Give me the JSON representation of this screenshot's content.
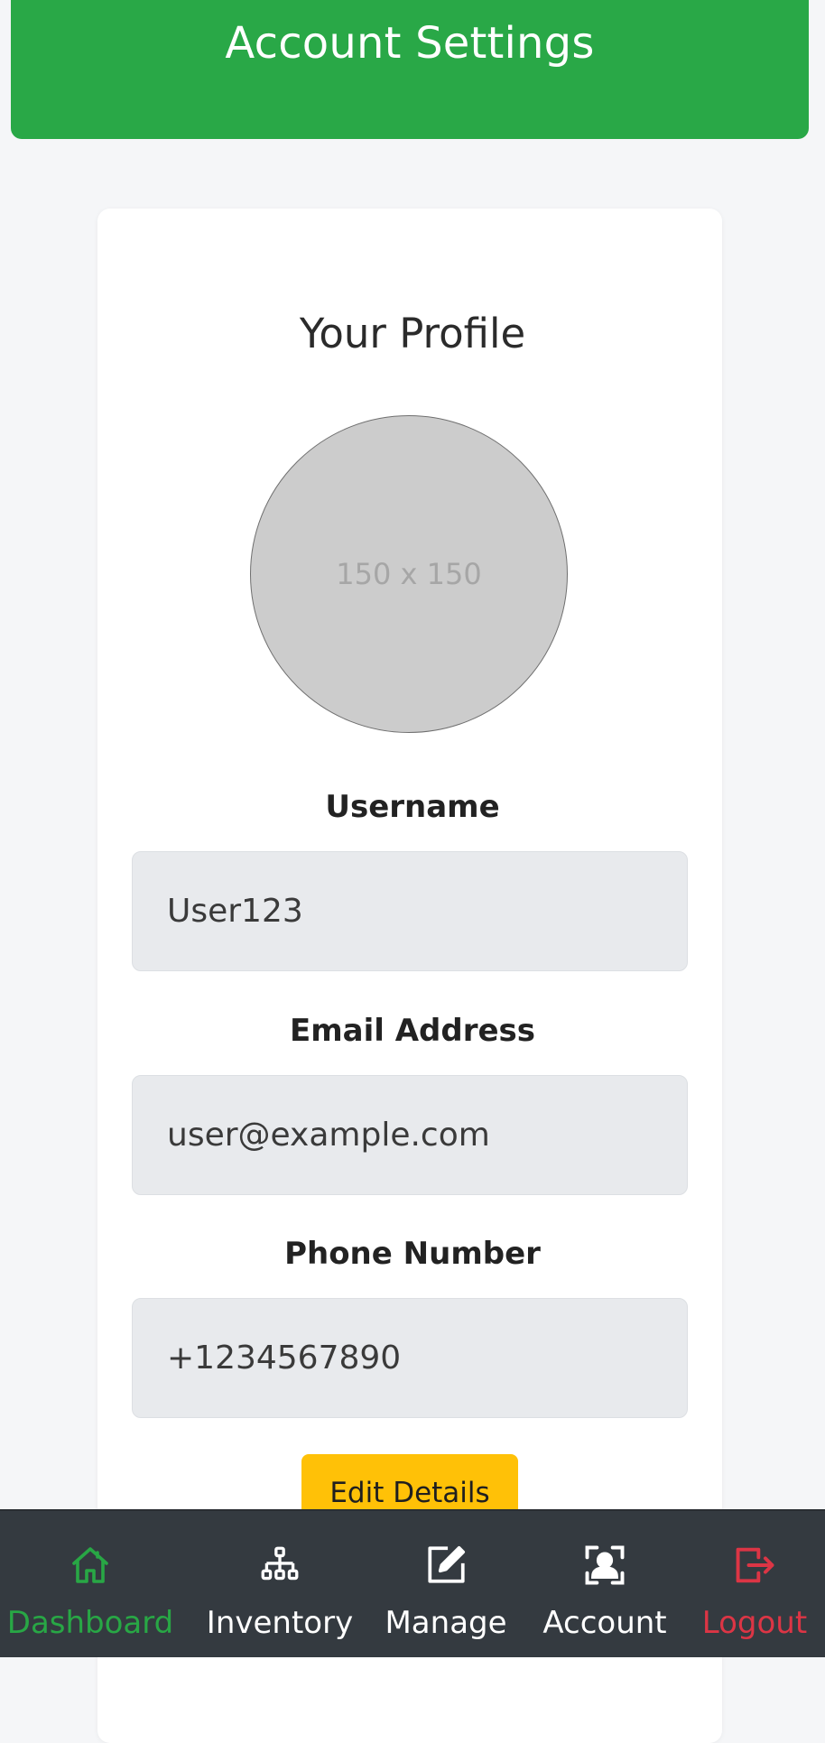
{
  "header": {
    "title": "Account Settings"
  },
  "profile": {
    "title": "Your Profile",
    "avatar_placeholder": "150 x 150",
    "fields": [
      {
        "label": "Username",
        "value": "User123"
      },
      {
        "label": "Email Address",
        "value": "user@example.com"
      },
      {
        "label": "Phone Number",
        "value": "+1234567890"
      }
    ],
    "edit_button": "Edit Details"
  },
  "nav": {
    "items": [
      {
        "label": "Dashboard",
        "icon": "home-icon"
      },
      {
        "label": "Inventory",
        "icon": "sitemap-icon"
      },
      {
        "label": "Manage",
        "icon": "edit-icon"
      },
      {
        "label": "Account",
        "icon": "user-scan-icon"
      },
      {
        "label": "Logout",
        "icon": "logout-icon"
      }
    ],
    "active": "Dashboard"
  },
  "colors": {
    "brand": "#29a847",
    "nav_bg": "#343a40",
    "active": "#28a745",
    "logout": "#dc3545",
    "button": "#ffc107"
  }
}
